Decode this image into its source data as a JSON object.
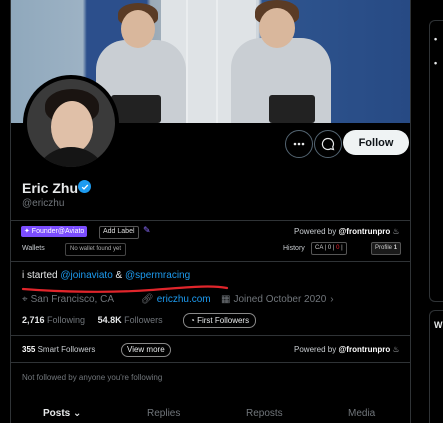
{
  "profile": {
    "name": "Eric Zhu",
    "handle": "@ericzhu",
    "follow_label": "Follow"
  },
  "labels": {
    "founder_tag": "✦ Founder@Aviato",
    "add_label": "Add Label",
    "powered_by_prefix": "Powered by",
    "powered_by_brand": "@frontrunpro",
    "wallets_label": "Wallets",
    "wallet_status": "No wallet found yet",
    "history_label": "History",
    "ca_label": "CA",
    "ca_count_a": "0",
    "ca_count_b": "0",
    "profile_label": "Profile",
    "profile_count": "1"
  },
  "bio": {
    "prefix": "i started ",
    "link1": "@joinaviato",
    "middle": " & ",
    "link2": "@spermracing"
  },
  "meta": {
    "location": "San Francisco, CA",
    "website": "ericzhu.com",
    "joined": "Joined October 2020"
  },
  "stats": {
    "following_count": "2,716",
    "following_label": "Following",
    "followers_count": "54.8K",
    "followers_label": "Followers",
    "first_followers": "First Followers"
  },
  "smart": {
    "count": "355",
    "label": "Smart Followers",
    "view_more": "View more",
    "powered_prefix": "Powered by",
    "powered_brand": "@frontrunpro"
  },
  "not_followed": "Not followed by anyone you're following",
  "tabs": [
    "Posts",
    "Replies",
    "Reposts",
    "Media"
  ],
  "colors": {
    "accent_blue": "#1d9bf0",
    "founder_purple": "#7b4dff",
    "annotation_red": "#e0252b"
  }
}
